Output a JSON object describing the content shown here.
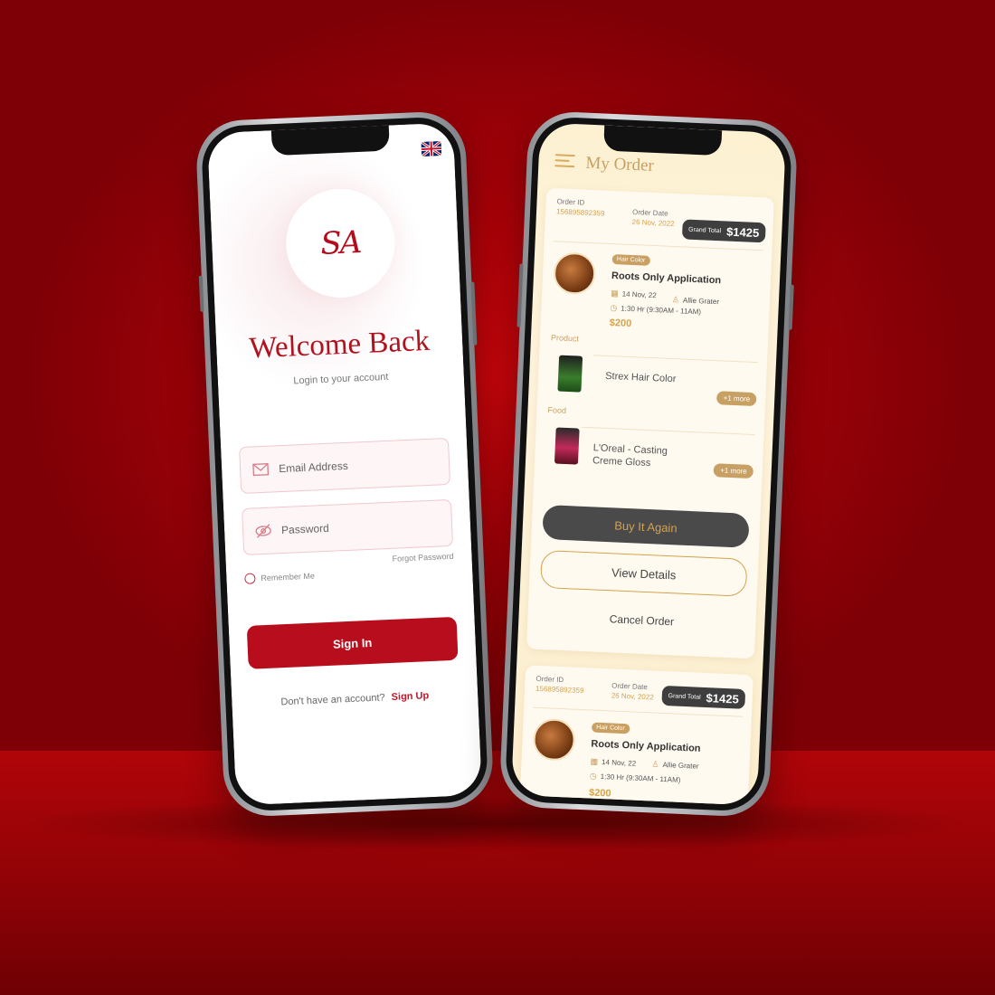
{
  "login": {
    "logo_text": "SA",
    "title": "Welcome Back",
    "subtitle": "Login to your account",
    "email_placeholder": "Email Address",
    "password_placeholder": "Password",
    "remember_label": "Remember Me",
    "forgot_label": "Forgot Password",
    "signin_label": "Sign In",
    "no_account_text": "Don't have an account?",
    "signup_label": "Sign Up"
  },
  "orders": {
    "title": "My Order",
    "list": [
      {
        "order_id_label": "Order ID",
        "order_id": "156895892359",
        "order_date_label": "Order Date",
        "order_date": "26 Nov, 2022",
        "grand_total_label": "Grand Total",
        "grand_total": "$1425",
        "service_tag": "Hair Color",
        "service_name": "Roots Only Application",
        "date": "14 Nov, 22",
        "stylist": "Allie Grater",
        "time": "1:30 Hr (9:30AM - 11AM)",
        "price": "$200"
      },
      {
        "order_id_label": "Order ID",
        "order_id": "156895892359",
        "order_date_label": "Order Date",
        "order_date": "26 Nov, 2022",
        "grand_total_label": "Grand Total",
        "grand_total": "$1425",
        "service_tag": "Hair Color",
        "service_name": "Roots Only Application",
        "date": "14 Nov, 22",
        "stylist": "Allie Grater",
        "time": "1:30 Hr (9:30AM - 11AM)",
        "price": "$200"
      }
    ],
    "product_section": "Product",
    "product_name": "Strex Hair Color",
    "food_section": "Food",
    "food_name": "L'Oreal - Casting Creme Gloss",
    "more_label": "+1 more",
    "buy_again_label": "Buy It Again",
    "view_details_label": "View Details",
    "cancel_label": "Cancel Order"
  },
  "colors": {
    "brand_red": "#b80d1c",
    "gold": "#d4a24d",
    "dark_button": "#4a4a4a"
  }
}
